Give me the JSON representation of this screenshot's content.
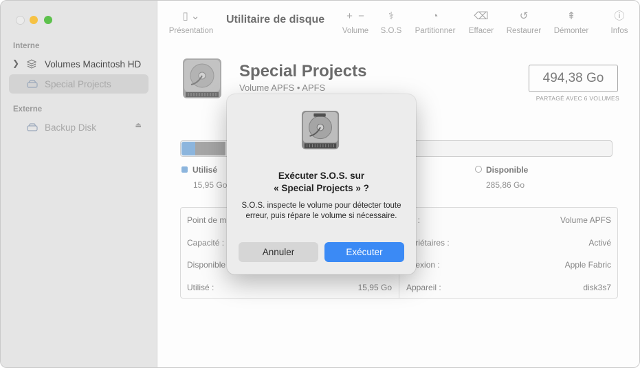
{
  "sidebar": {
    "section_internal": "Interne",
    "section_external": "Externe",
    "items": [
      {
        "label": "Volumes Macintosh HD"
      },
      {
        "label": "Special Projects"
      },
      {
        "label": "Backup Disk"
      }
    ]
  },
  "toolbar": {
    "view_label": "Présentation",
    "title": "Utilitaire de disque",
    "volume_label": "Volume",
    "sos_label": "S.O.S",
    "partition_label": "Partitionner",
    "erase_label": "Effacer",
    "restore_label": "Restaurer",
    "unmount_label": "Démonter",
    "info_label": "Infos"
  },
  "volume": {
    "name": "Special Projects",
    "subtitle": "Volume APFS • APFS",
    "capacity": "494,38 Go",
    "capacity_note": "PARTAGÉ AVEC 6 VOLUMES"
  },
  "usage": {
    "used_fraction": 0.032,
    "other_fraction": 0.07,
    "used_label": "Utilisé",
    "used_value": "15,95 Go",
    "free_label": "Disponible",
    "free_value": "285,86 Go"
  },
  "info": {
    "left": [
      {
        "label": "Point de m",
        "value": ""
      },
      {
        "label": "Capacité :",
        "value": ""
      },
      {
        "label": "Disponible",
        "value": ""
      },
      {
        "label": "Utilisé :",
        "value": "15,95 Go"
      }
    ],
    "right": [
      {
        "label": "pe :",
        "value": "Volume APFS"
      },
      {
        "label": "opriétaires :",
        "value": "Activé"
      },
      {
        "label": "nnexion :",
        "value": "Apple Fabric"
      },
      {
        "label": "Appareil :",
        "value": "disk3s7"
      }
    ]
  },
  "dialog": {
    "title_line1": "Exécuter S.O.S. sur",
    "title_line2": "« Special Projects » ?",
    "message": "S.O.S. inspecte le volume pour détecter toute erreur, puis répare le volume si nécessaire.",
    "cancel_label": "Annuler",
    "run_label": "Exécuter"
  },
  "colors": {
    "accent": "#3b8af5",
    "used": "#8cb5dd",
    "other": "#a6a6a6"
  }
}
